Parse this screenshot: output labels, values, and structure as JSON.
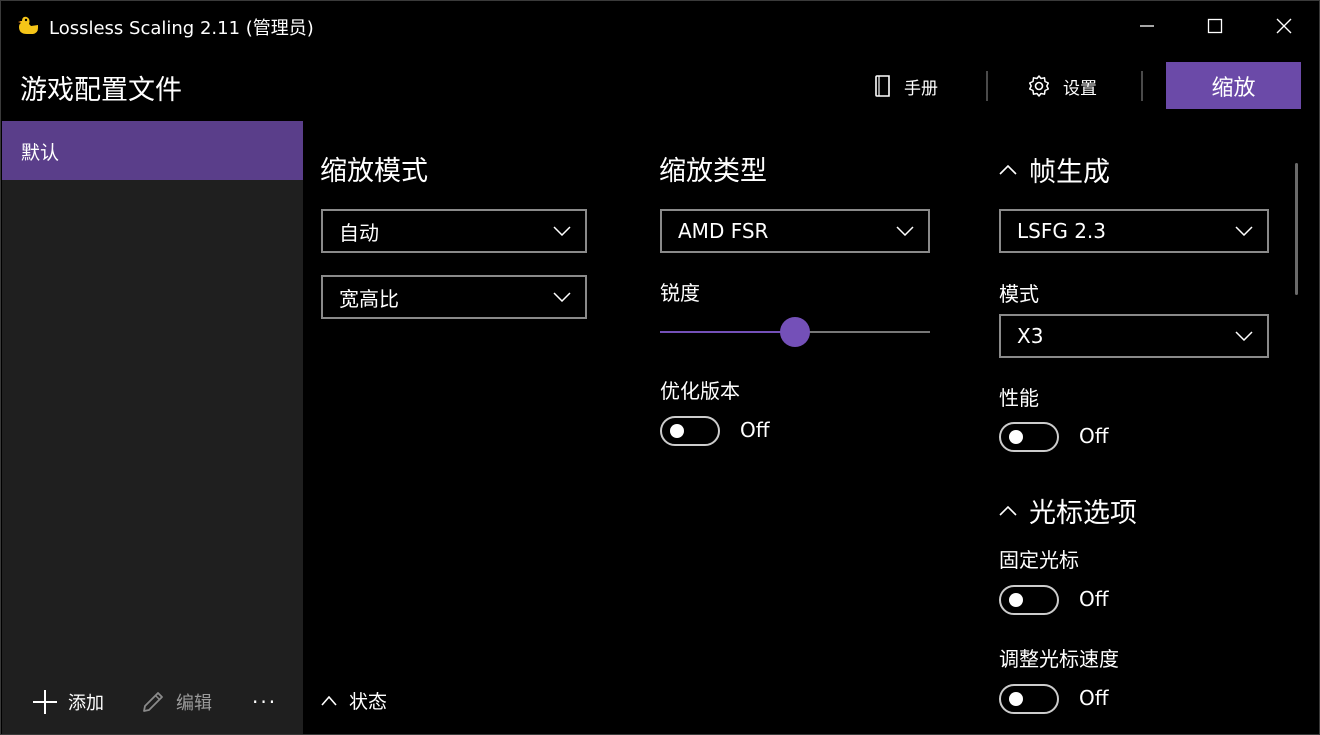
{
  "window": {
    "title": "Lossless Scaling 2.11 (管理员)"
  },
  "header": {
    "page_title": "游戏配置文件",
    "manual_label": "手册",
    "settings_label": "设置",
    "scale_button_label": "缩放"
  },
  "sidebar": {
    "items": [
      {
        "label": "默认",
        "selected": true
      }
    ],
    "actions": {
      "add_label": "添加",
      "edit_label": "编辑",
      "more_label": "···"
    }
  },
  "scaling_mode": {
    "title": "缩放模式",
    "mode_value": "自动",
    "aspect_value": "宽高比"
  },
  "scaling_type": {
    "title": "缩放类型",
    "type_value": "AMD FSR",
    "sharpness_label": "锐度",
    "sharpness_value": 0.5,
    "optimized_label": "优化版本",
    "optimized_state": "Off"
  },
  "frame_gen": {
    "title": "帧生成",
    "version_value": "LSFG 2.3",
    "mode_label": "模式",
    "mode_value": "X3",
    "performance_label": "性能",
    "performance_state": "Off"
  },
  "cursor": {
    "title": "光标选项",
    "clip_label": "固定光标",
    "clip_state": "Off",
    "speed_label": "调整光标速度",
    "speed_state": "Off"
  },
  "status": {
    "label": "状态"
  },
  "colors": {
    "accent": "#6b4aa8",
    "selected": "#5a3e8a",
    "sidebar_bg": "#1f1f1f",
    "background": "#000000"
  }
}
